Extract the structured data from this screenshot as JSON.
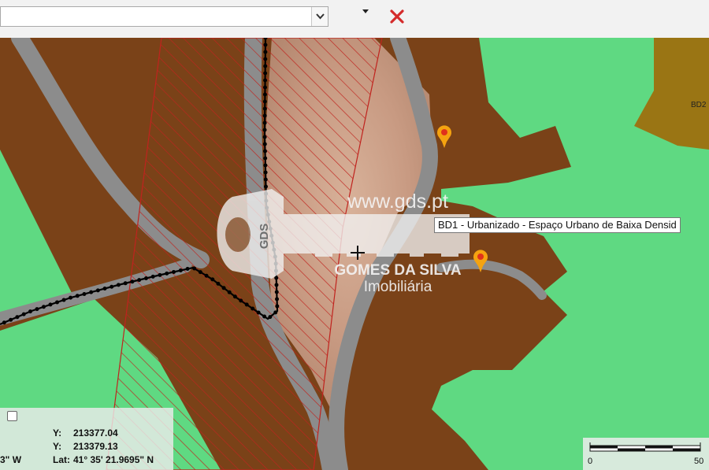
{
  "toolbar": {
    "search_value": "",
    "icons": [
      "chevron-down-icon",
      "caret-down-icon",
      "close-icon"
    ],
    "close_color": "#d42b2b"
  },
  "map": {
    "colors": {
      "urban_land": "#7a4218",
      "green_space": "#5fd982",
      "bd2_zone": "#9a7514",
      "road": "#8c8c8c",
      "hatch": "#c0231e",
      "boundary": "#000000",
      "marker": "#f5a310"
    },
    "zone_labels": [
      {
        "name": "zone-label-bd2",
        "text": "BD2"
      }
    ],
    "markers": 2
  },
  "watermark": {
    "key_text": "GDS",
    "url": "www.gds.pt",
    "brand": "GOMES DA SILVA",
    "sub": "Imobiliária"
  },
  "tooltip": {
    "text": "BD1 - Urbanizado - Espaço Urbano de Baixa Densid"
  },
  "coords": {
    "y_label": "Y:",
    "y1": "213377.04",
    "y2": "213379.13",
    "lon_fragment": "3\" W",
    "lat_label": "Lat:",
    "lat": "41° 35' 21.9695\" N"
  },
  "scale": {
    "start": "0",
    "end": "50"
  }
}
